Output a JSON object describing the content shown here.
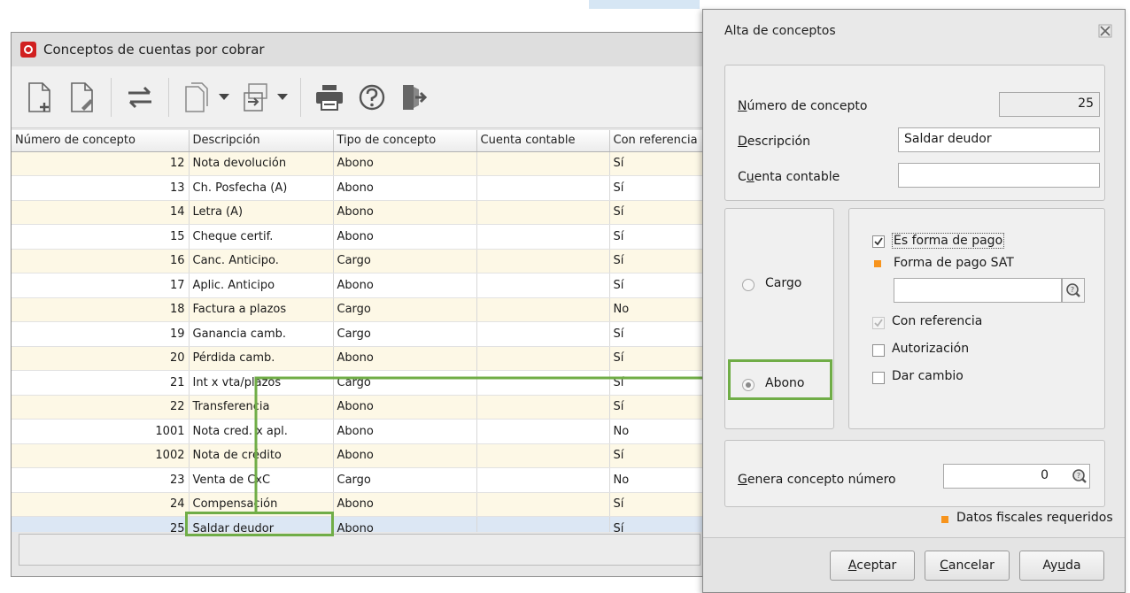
{
  "main_window": {
    "title": "Conceptos de cuentas por cobrar",
    "toolbar_icons": [
      "new-document-icon",
      "edit-document-icon",
      "swap-arrows-icon",
      "copy-icon",
      "import-export-icon",
      "print-icon",
      "help-icon",
      "exit-icon"
    ],
    "columns": [
      "Número de concepto",
      "Descripción",
      "Tipo de concepto",
      "Cuenta contable",
      "Con referencia"
    ],
    "rows": [
      {
        "num": "12",
        "desc": "Nota devolución",
        "tipo": "Abono",
        "cuenta": "",
        "ref": "Sí"
      },
      {
        "num": "13",
        "desc": "Ch. Posfecha (A)",
        "tipo": "Abono",
        "cuenta": "",
        "ref": "Sí"
      },
      {
        "num": "14",
        "desc": "Letra (A)",
        "tipo": "Abono",
        "cuenta": "",
        "ref": "Sí"
      },
      {
        "num": "15",
        "desc": "Cheque certif.",
        "tipo": "Abono",
        "cuenta": "",
        "ref": "Sí"
      },
      {
        "num": "16",
        "desc": "Canc. Anticipo.",
        "tipo": "Cargo",
        "cuenta": "",
        "ref": "Sí"
      },
      {
        "num": "17",
        "desc": "Aplic. Anticipo",
        "tipo": "Abono",
        "cuenta": "",
        "ref": "Sí"
      },
      {
        "num": "18",
        "desc": "Factura a plazos",
        "tipo": "Cargo",
        "cuenta": "",
        "ref": "No"
      },
      {
        "num": "19",
        "desc": "Ganancia camb.",
        "tipo": "Cargo",
        "cuenta": "",
        "ref": "Sí"
      },
      {
        "num": "20",
        "desc": "Pérdida camb.",
        "tipo": "Abono",
        "cuenta": "",
        "ref": "Sí"
      },
      {
        "num": "21",
        "desc": "Int x vta/plazos",
        "tipo": "Cargo",
        "cuenta": "",
        "ref": "Sí"
      },
      {
        "num": "22",
        "desc": "Transferencia",
        "tipo": "Abono",
        "cuenta": "",
        "ref": "Sí"
      },
      {
        "num": "1001",
        "desc": "Nota cred. x apl.",
        "tipo": "Abono",
        "cuenta": "",
        "ref": "No"
      },
      {
        "num": "1002",
        "desc": "Nota de crédito",
        "tipo": "Abono",
        "cuenta": "",
        "ref": "Sí"
      },
      {
        "num": "23",
        "desc": "Venta de CxC",
        "tipo": "Cargo",
        "cuenta": "",
        "ref": "No"
      },
      {
        "num": "24",
        "desc": "Compensación",
        "tipo": "Abono",
        "cuenta": "",
        "ref": "Sí"
      },
      {
        "num": "25",
        "desc": "Saldar deudor",
        "tipo": "Abono",
        "cuenta": "",
        "ref": "Sí"
      }
    ],
    "selected_row": 15
  },
  "dialog": {
    "title": "Alta de conceptos",
    "numero_label": "Número de concepto",
    "numero_value": "25",
    "descripcion_label": "Descripción",
    "descripcion_value": "Saldar deudor",
    "cuenta_label": "Cuenta contable",
    "cuenta_value": "",
    "cargo_label": "Cargo",
    "abono_label": "Abono",
    "selected_type": "Abono",
    "forma_pago_label": "Es forma de pago",
    "forma_pago_checked": true,
    "forma_pago_sat_label": "Forma de pago SAT",
    "forma_pago_sat_value": "",
    "con_referencia_label": "Con referencia",
    "con_referencia_checked": true,
    "autorizacion_label": "Autorización",
    "autorizacion_checked": false,
    "dar_cambio_label": "Dar cambio",
    "dar_cambio_checked": false,
    "genera_label": "Genera concepto número",
    "genera_value": "0",
    "fiscal_note": "Datos fiscales requeridos",
    "buttons": {
      "aceptar": "Aceptar",
      "cancelar": "Cancelar",
      "ayuda": "Ayuda"
    }
  },
  "colors": {
    "highlight": "#70ad47",
    "required_marker": "#f7941d",
    "row_alt": "#fdf8e6",
    "app_icon": "#d12020"
  }
}
